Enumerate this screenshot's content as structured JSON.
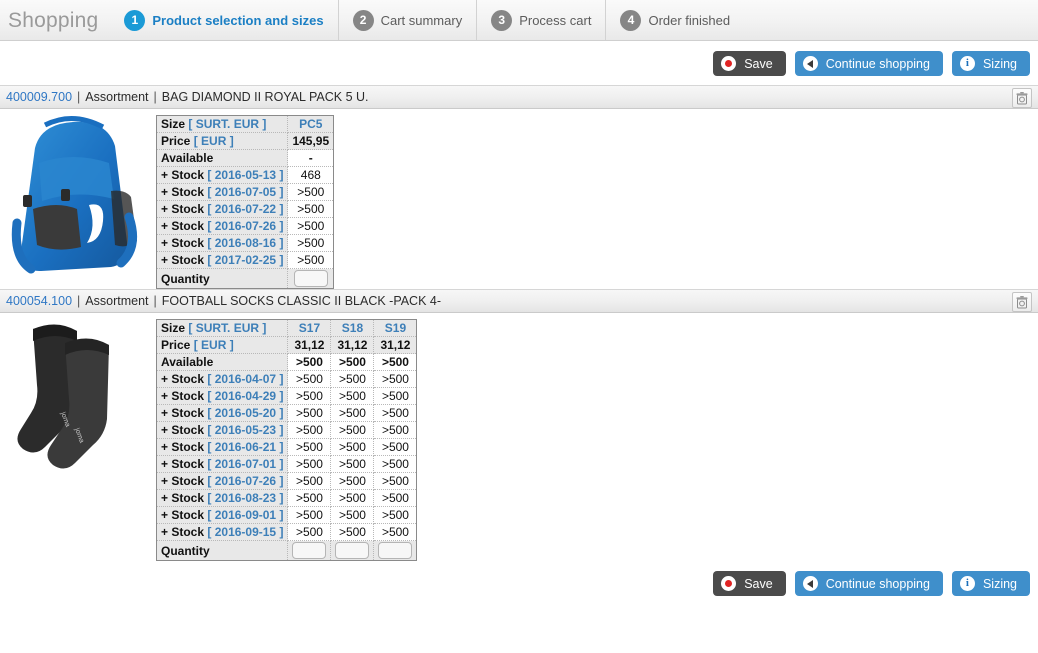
{
  "header": {
    "title": "Shopping",
    "steps": [
      {
        "number": "1",
        "label": "Product selection and sizes",
        "state": "active"
      },
      {
        "number": "2",
        "label": "Cart summary",
        "state": "inactive"
      },
      {
        "number": "3",
        "label": "Process cart",
        "state": "inactive"
      },
      {
        "number": "4",
        "label": "Order finished",
        "state": "inactive"
      }
    ],
    "active_color": "#1b9ad6",
    "inactive_color": "#868686",
    "title_color": "#9a9a9a"
  },
  "toolbar": {
    "save_label": "Save",
    "continue_label": "Continue shopping",
    "sizing_label": "Sizing",
    "save_color": "#4b4b4b",
    "blue_color": "#3f8fcb",
    "save_icon": "record-dot-icon",
    "continue_icon": "arrow-left-circle-icon",
    "sizing_icon": "info-circle-icon"
  },
  "labels": {
    "size": "Size",
    "size_unit": "SURT. EUR",
    "price": "Price",
    "price_unit": "EUR",
    "available": "Available",
    "stock": "+ Stock",
    "quantity": "Quantity",
    "separator": "|",
    "bracket_open": "[",
    "bracket_close": "]",
    "delete_icon": "trash-icon"
  },
  "products": [
    {
      "code": "400009.700",
      "type": "Assortment",
      "name": "BAG DIAMOND II ROYAL PACK 5 U.",
      "image": "blue-backpack",
      "sizes": [
        "PC5"
      ],
      "prices": [
        "145,95"
      ],
      "available": [
        "-"
      ],
      "stock_rows": [
        {
          "date": "2016-05-13",
          "values": [
            "468"
          ]
        },
        {
          "date": "2016-07-05",
          "values": [
            ">500"
          ]
        },
        {
          "date": "2016-07-22",
          "values": [
            ">500"
          ]
        },
        {
          "date": "2016-07-26",
          "values": [
            ">500"
          ]
        },
        {
          "date": "2016-08-16",
          "values": [
            ">500"
          ]
        },
        {
          "date": "2017-02-25",
          "values": [
            ">500"
          ]
        }
      ],
      "quantities": [
        ""
      ]
    },
    {
      "code": "400054.100",
      "type": "Assortment",
      "name": "FOOTBALL SOCKS CLASSIC II BLACK -PACK 4-",
      "image": "black-socks",
      "sizes": [
        "S17",
        "S18",
        "S19"
      ],
      "prices": [
        "31,12",
        "31,12",
        "31,12"
      ],
      "available": [
        ">500",
        ">500",
        ">500"
      ],
      "stock_rows": [
        {
          "date": "2016-04-07",
          "values": [
            ">500",
            ">500",
            ">500"
          ]
        },
        {
          "date": "2016-04-29",
          "values": [
            ">500",
            ">500",
            ">500"
          ]
        },
        {
          "date": "2016-05-20",
          "values": [
            ">500",
            ">500",
            ">500"
          ]
        },
        {
          "date": "2016-05-23",
          "values": [
            ">500",
            ">500",
            ">500"
          ]
        },
        {
          "date": "2016-06-21",
          "values": [
            ">500",
            ">500",
            ">500"
          ]
        },
        {
          "date": "2016-07-01",
          "values": [
            ">500",
            ">500",
            ">500"
          ]
        },
        {
          "date": "2016-07-26",
          "values": [
            ">500",
            ">500",
            ">500"
          ]
        },
        {
          "date": "2016-08-23",
          "values": [
            ">500",
            ">500",
            ">500"
          ]
        },
        {
          "date": "2016-09-01",
          "values": [
            ">500",
            ">500",
            ">500"
          ]
        },
        {
          "date": "2016-09-15",
          "values": [
            ">500",
            ">500",
            ">500"
          ]
        }
      ],
      "quantities": [
        "",
        "",
        ""
      ]
    }
  ]
}
